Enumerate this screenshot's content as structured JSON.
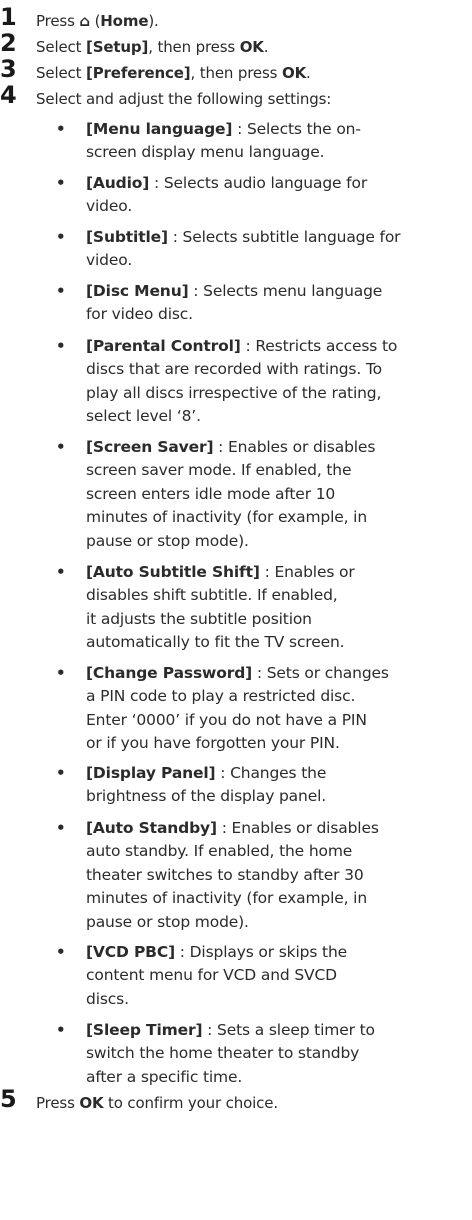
{
  "steps": [
    {
      "number": "1",
      "text_before": "Press ",
      "icon": "home-icon",
      "icon_glyph": "⌂",
      "text_paren_open": " (",
      "bold": "Home",
      "text_after": ")."
    },
    {
      "number": "2",
      "text_before": "Select ",
      "bold1": "[Setup]",
      "text_mid": ", then press ",
      "bold2": "OK",
      "text_after": "."
    },
    {
      "number": "3",
      "text_before": "Select ",
      "bold1": "[Preference]",
      "text_mid": ", then press ",
      "bold2": "OK",
      "text_after": "."
    },
    {
      "number": "4",
      "text": "Select and adjust the following settings:"
    },
    {
      "number": "5",
      "text_before": "Press ",
      "bold": "OK",
      "text_after": " to confirm your choice."
    }
  ],
  "bullet_symbol": "•",
  "settings": [
    {
      "label": "[Menu language]",
      "lines": [
        " : Selects the on-",
        "screen display menu language."
      ]
    },
    {
      "label": "[Audio]",
      "lines": [
        " : Selects audio language for",
        "video."
      ]
    },
    {
      "label": "[Subtitle]",
      "lines": [
        " : Selects subtitle language for",
        "video."
      ]
    },
    {
      "label": "[Disc Menu]",
      "lines": [
        " : Selects menu language",
        "for video disc."
      ]
    },
    {
      "label": "[Parental Control]",
      "lines": [
        " : Restricts access to",
        "discs that are recorded with ratings. To",
        "play all discs irrespective of the rating,",
        "select level ‘8’."
      ]
    },
    {
      "label": "[Screen Saver]",
      "lines": [
        " : Enables or disables",
        "screen saver mode. If enabled, the",
        "screen enters idle mode after 10",
        "minutes of inactivity (for example, in",
        "pause or stop mode)."
      ]
    },
    {
      "label": "[Auto Subtitle Shift]",
      "lines": [
        " : Enables or",
        "disables shift subtitle. If enabled,",
        "it adjusts the subtitle position",
        "automatically to fit the TV screen."
      ]
    },
    {
      "label": "[Change Password]",
      "lines": [
        " : Sets or changes",
        "a PIN code to play a restricted disc.",
        "Enter ‘0000’ if you do not have a PIN",
        "or if you have forgotten your PIN."
      ]
    },
    {
      "label": "[Display Panel]",
      "lines": [
        " : Changes the",
        "brightness of the display panel."
      ]
    },
    {
      "label": "[Auto Standby]",
      "lines": [
        " : Enables or disables",
        "auto standby. If enabled, the home",
        "theater switches to standby after 30",
        "minutes of inactivity (for example, in",
        "pause or stop mode)."
      ]
    },
    {
      "label": "[VCD PBC]",
      "lines": [
        " : Displays or skips the",
        "content menu for VCD and SVCD",
        "discs."
      ]
    },
    {
      "label": "[Sleep Timer]",
      "lines": [
        " : Sets a sleep timer to",
        "switch the home theater to standby",
        "after a specific time."
      ]
    }
  ]
}
